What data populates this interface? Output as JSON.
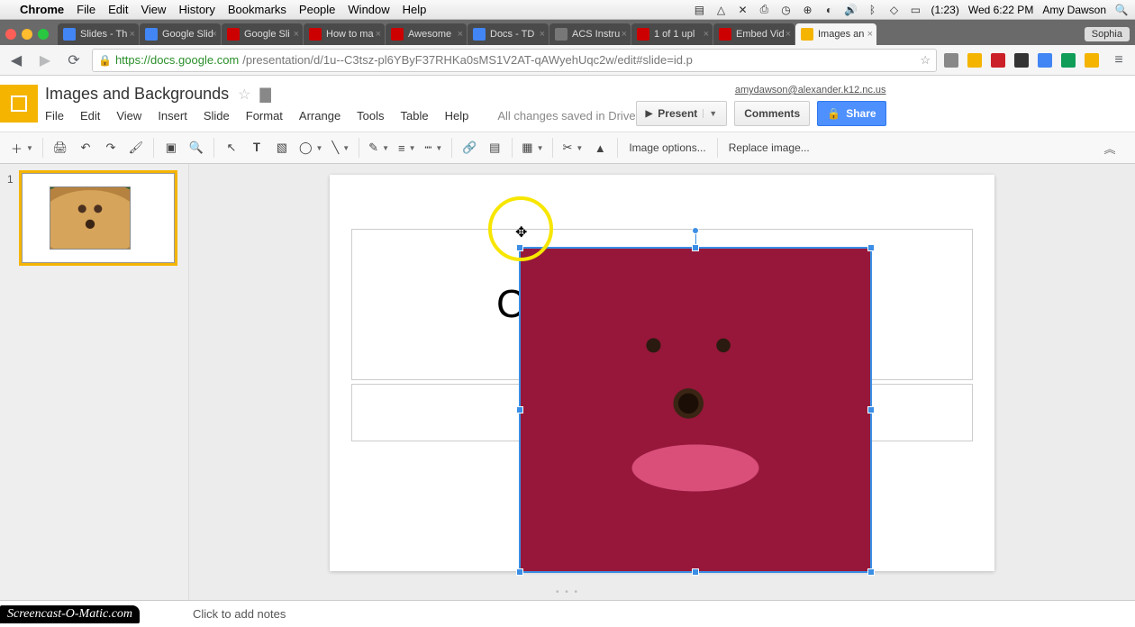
{
  "mac": {
    "app": "Chrome",
    "menus": [
      "File",
      "Edit",
      "View",
      "History",
      "Bookmarks",
      "People",
      "Window",
      "Help"
    ],
    "battery": "(1:23)",
    "clock": "Wed 6:22 PM",
    "user": "Amy Dawson"
  },
  "chrome": {
    "profile": "Sophia",
    "tabs": [
      {
        "title": "Slides - Th",
        "fav": "#4285f4"
      },
      {
        "title": "Google Slid",
        "fav": "#4285f4"
      },
      {
        "title": "Google Sli",
        "fav": "#cc0000"
      },
      {
        "title": "How to ma",
        "fav": "#cc0000"
      },
      {
        "title": "Awesome",
        "fav": "#cc0000"
      },
      {
        "title": "Docs - TD",
        "fav": "#4285f4"
      },
      {
        "title": "ACS Instru",
        "fav": "#777777"
      },
      {
        "title": "1 of 1 upl",
        "fav": "#cc0000"
      },
      {
        "title": "Embed Vid",
        "fav": "#cc0000"
      },
      {
        "title": "Images an",
        "fav": "#f4b400",
        "active": true
      }
    ],
    "url_host": "https://docs.google.com",
    "url_path": "/presentation/d/1u--C3tsz-pl6YByF37RHKa0sMS1V2AT-qAWyehUqc2w/edit#slide=id.p"
  },
  "slides": {
    "title": "Images and Backgrounds",
    "email": "amydawson@alexander.k12.nc.us",
    "menus": [
      "File",
      "Edit",
      "View",
      "Insert",
      "Slide",
      "Format",
      "Arrange",
      "Tools",
      "Table",
      "Help"
    ],
    "status": "All changes saved in Drive",
    "buttons": {
      "present": "Present",
      "comments": "Comments",
      "share": "Share"
    },
    "toolbar": {
      "image_options": "Image options...",
      "replace_image": "Replace image..."
    },
    "thumb_num": "1",
    "placeholder_letter": "C",
    "notes_placeholder": "Click to add notes"
  },
  "watermark": "Screencast-O-Matic.com"
}
